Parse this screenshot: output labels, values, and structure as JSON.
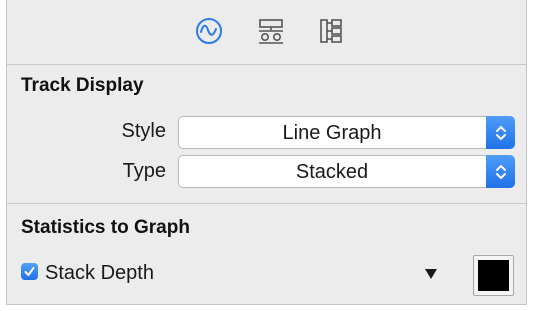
{
  "toolbar": {
    "icons": [
      {
        "name": "graph-wave-icon",
        "selected": true
      },
      {
        "name": "detail-panel-icon",
        "selected": false
      },
      {
        "name": "tree-hierarchy-icon",
        "selected": false
      }
    ],
    "accent_color": "#2b7ce8",
    "icon_color": "#555555"
  },
  "track_display": {
    "title": "Track Display",
    "style": {
      "label": "Style",
      "value": "Line Graph"
    },
    "type": {
      "label": "Type",
      "value": "Stacked"
    }
  },
  "statistics": {
    "title": "Statistics to Graph",
    "items": [
      {
        "label": "Stack Depth",
        "checked": true,
        "color": "#000000"
      }
    ]
  }
}
